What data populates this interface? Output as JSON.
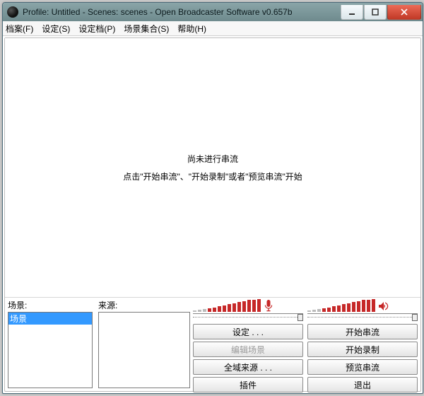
{
  "window": {
    "title": "Profile: Untitled - Scenes: scenes - Open Broadcaster Software v0.657b"
  },
  "menubar": {
    "items": [
      {
        "label": "档案(F)"
      },
      {
        "label": "设定(S)"
      },
      {
        "label": "设定档(P)"
      },
      {
        "label": "场景集合(S)"
      },
      {
        "label": "帮助(H)"
      }
    ]
  },
  "preview": {
    "line1": "尚未进行串流",
    "line2": "点击\"开始串流\"、\"开始录制\"或者\"预览串流\"开始"
  },
  "panels": {
    "scenes": {
      "label": "场景:",
      "items": [
        {
          "label": "场景",
          "selected": true
        }
      ]
    },
    "sources": {
      "label": "来源:",
      "items": []
    }
  },
  "audio": {
    "mic": {
      "level_pct": 100,
      "icon": "microphone-icon",
      "slider_pct": 100
    },
    "speaker": {
      "level_pct": 100,
      "icon": "speaker-icon",
      "slider_pct": 100
    }
  },
  "buttons": {
    "settings": "设定 . . .",
    "start_stream": "开始串流",
    "edit_scene": "编辑场景",
    "start_record": "开始录制",
    "global_sources": "全域来源 . . .",
    "preview_stream": "预览串流",
    "plugins": "插件",
    "exit": "退出"
  }
}
